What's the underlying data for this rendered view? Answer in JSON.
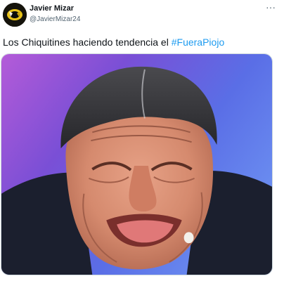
{
  "tweet": {
    "author": {
      "display_name": "Javier Mizar",
      "handle": "@JavierMizar24"
    },
    "more_icon": "more-horizontal-icon",
    "more_label": "···",
    "text": "Los Chiquitines haciendo tendencia el ",
    "hashtag": "#FueraPiojo",
    "media": {
      "subject": "close-up of a man grimacing with eyes squeezed shut and tongue pressed out"
    }
  },
  "colors": {
    "text": "#0f1419",
    "secondary": "#536471",
    "link": "#1d9bf0",
    "border": "#cfd9de"
  }
}
